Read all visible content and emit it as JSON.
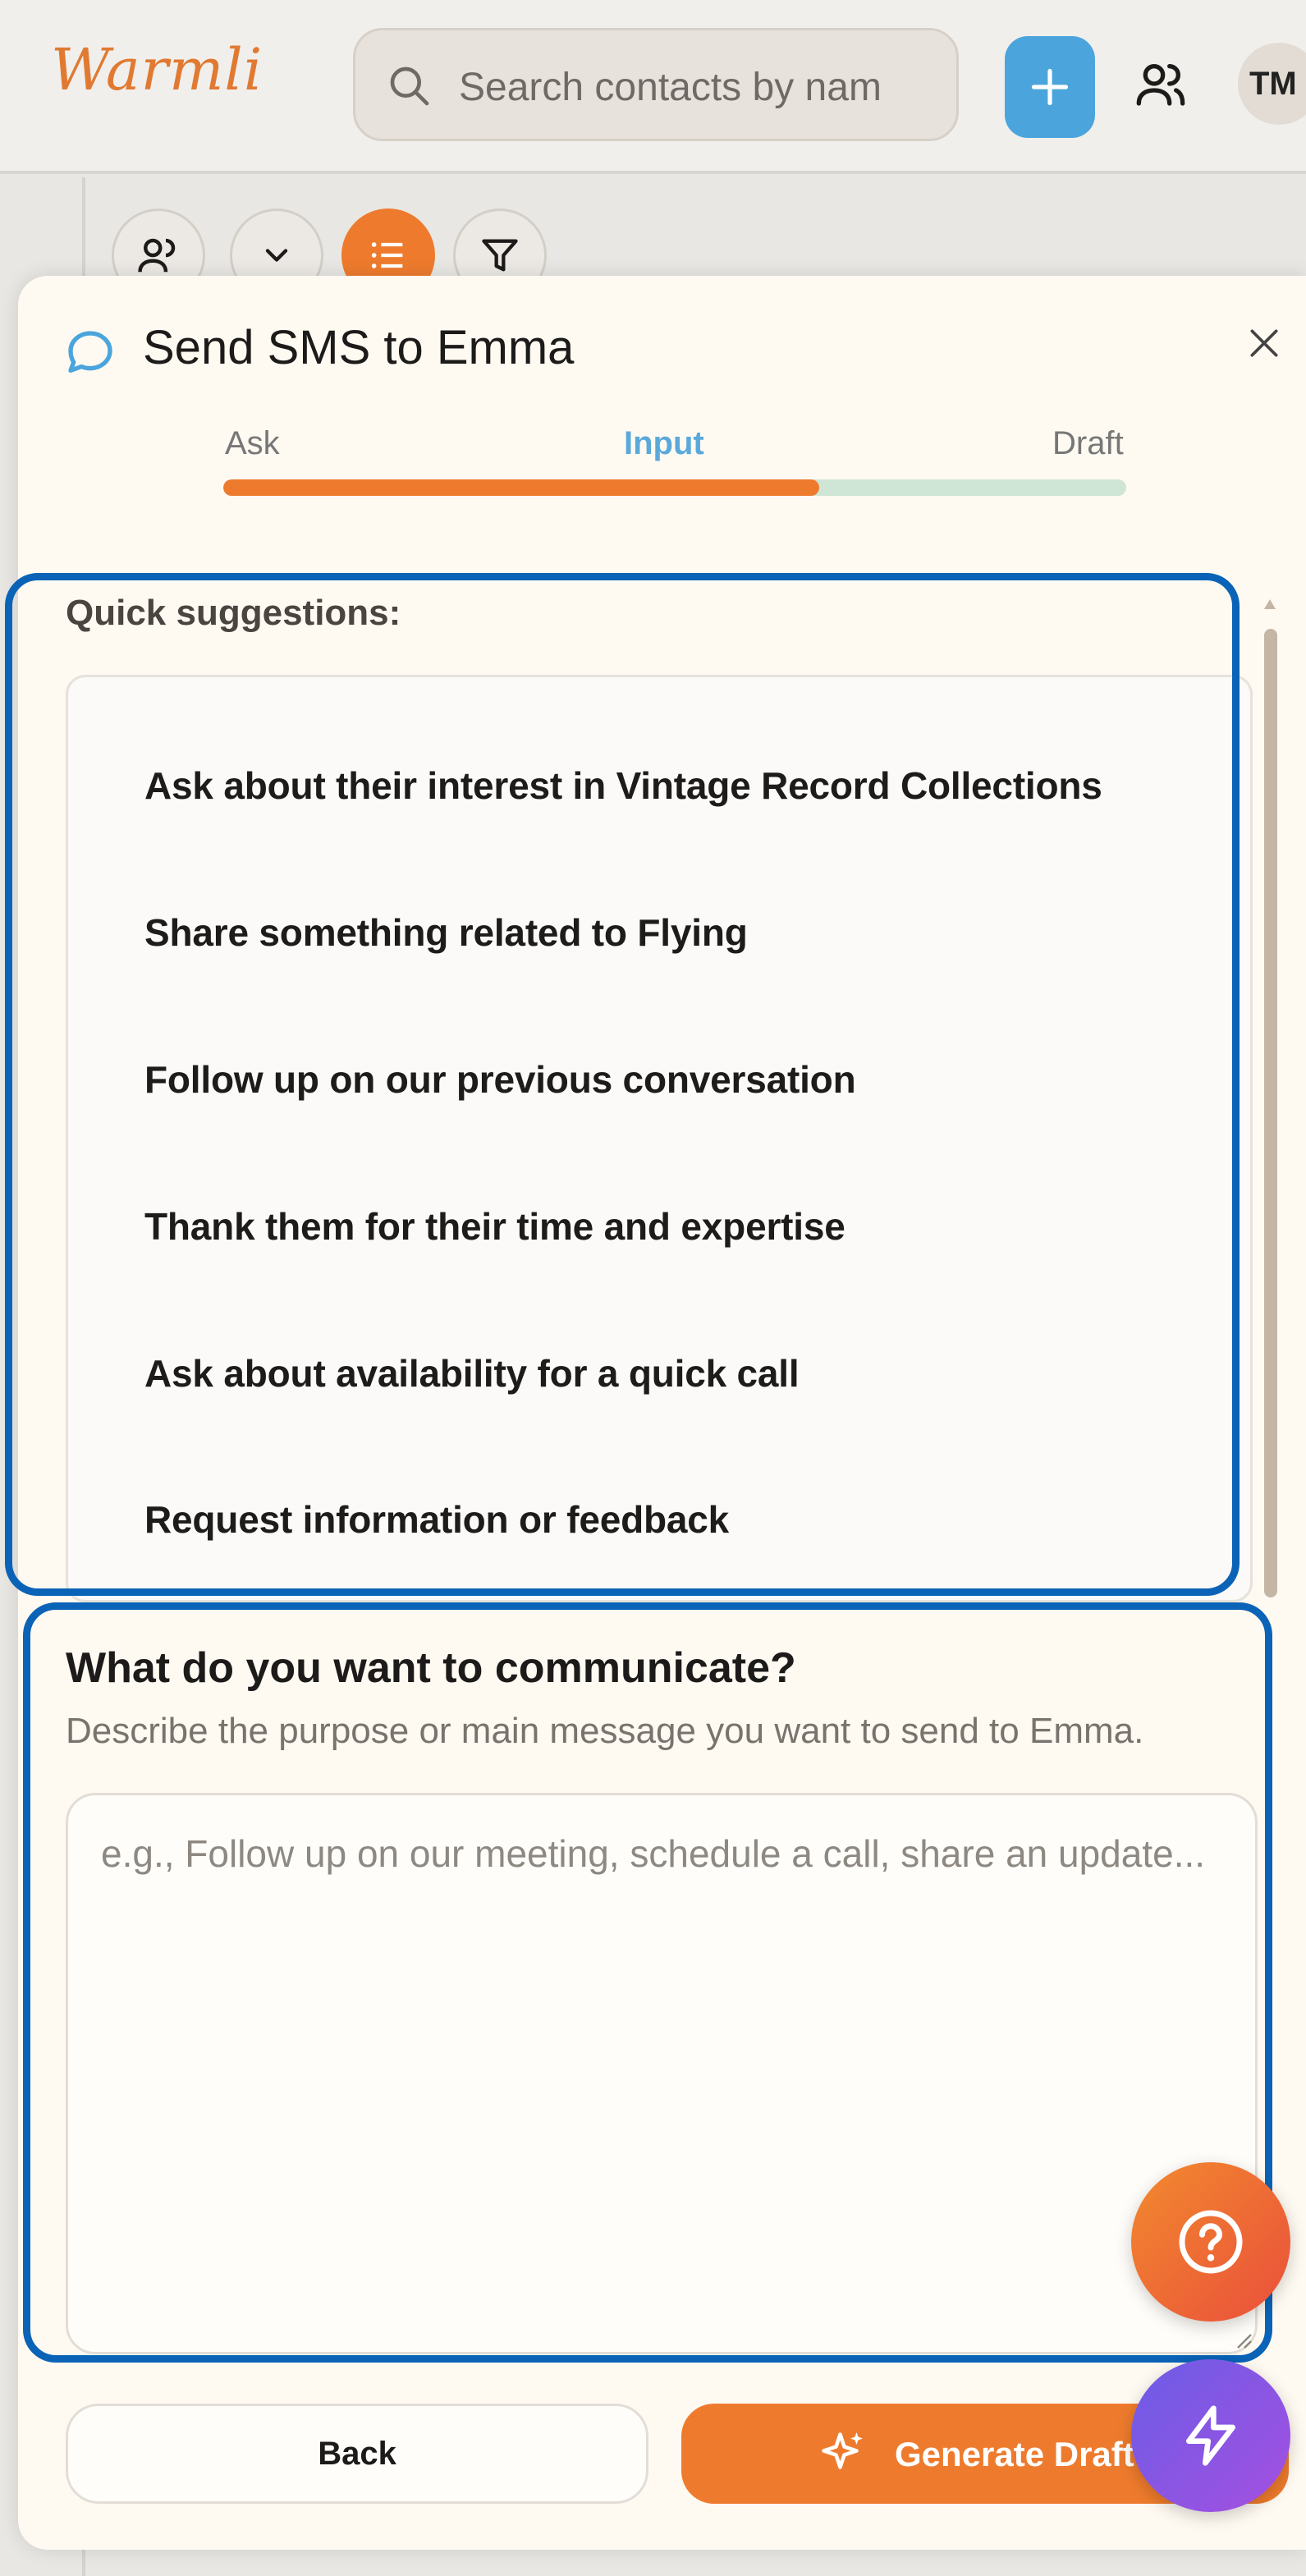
{
  "header": {
    "logo": "Warmli",
    "search_placeholder": "Search contacts by nam",
    "avatar_initials": "TM"
  },
  "modal": {
    "title": "Send SMS to Emma",
    "steps": [
      "Ask",
      "Input",
      "Draft"
    ],
    "active_step": "Input",
    "progress_fraction": 0.66
  },
  "suggestions": {
    "label": "Quick suggestions:",
    "items": [
      "Ask about their interest in Vintage Record Collections",
      "Share something related to Flying",
      "Follow up on our previous conversation",
      "Thank them for their time and expertise",
      "Ask about availability for a quick call",
      "Request information or feedback"
    ]
  },
  "communicate": {
    "title": "What do you want to communicate?",
    "description": "Describe the purpose or main message you want to send to Emma.",
    "placeholder": "e.g., Follow up on our meeting, schedule a call, share an update...",
    "value": ""
  },
  "actions": {
    "back_label": "Back",
    "generate_label": "Generate Draft"
  },
  "colors": {
    "accent": "#ee7b2d",
    "active_step": "#5aa9da",
    "highlight": "#0a63b6",
    "progress_remaining": "#cfe5d6"
  }
}
